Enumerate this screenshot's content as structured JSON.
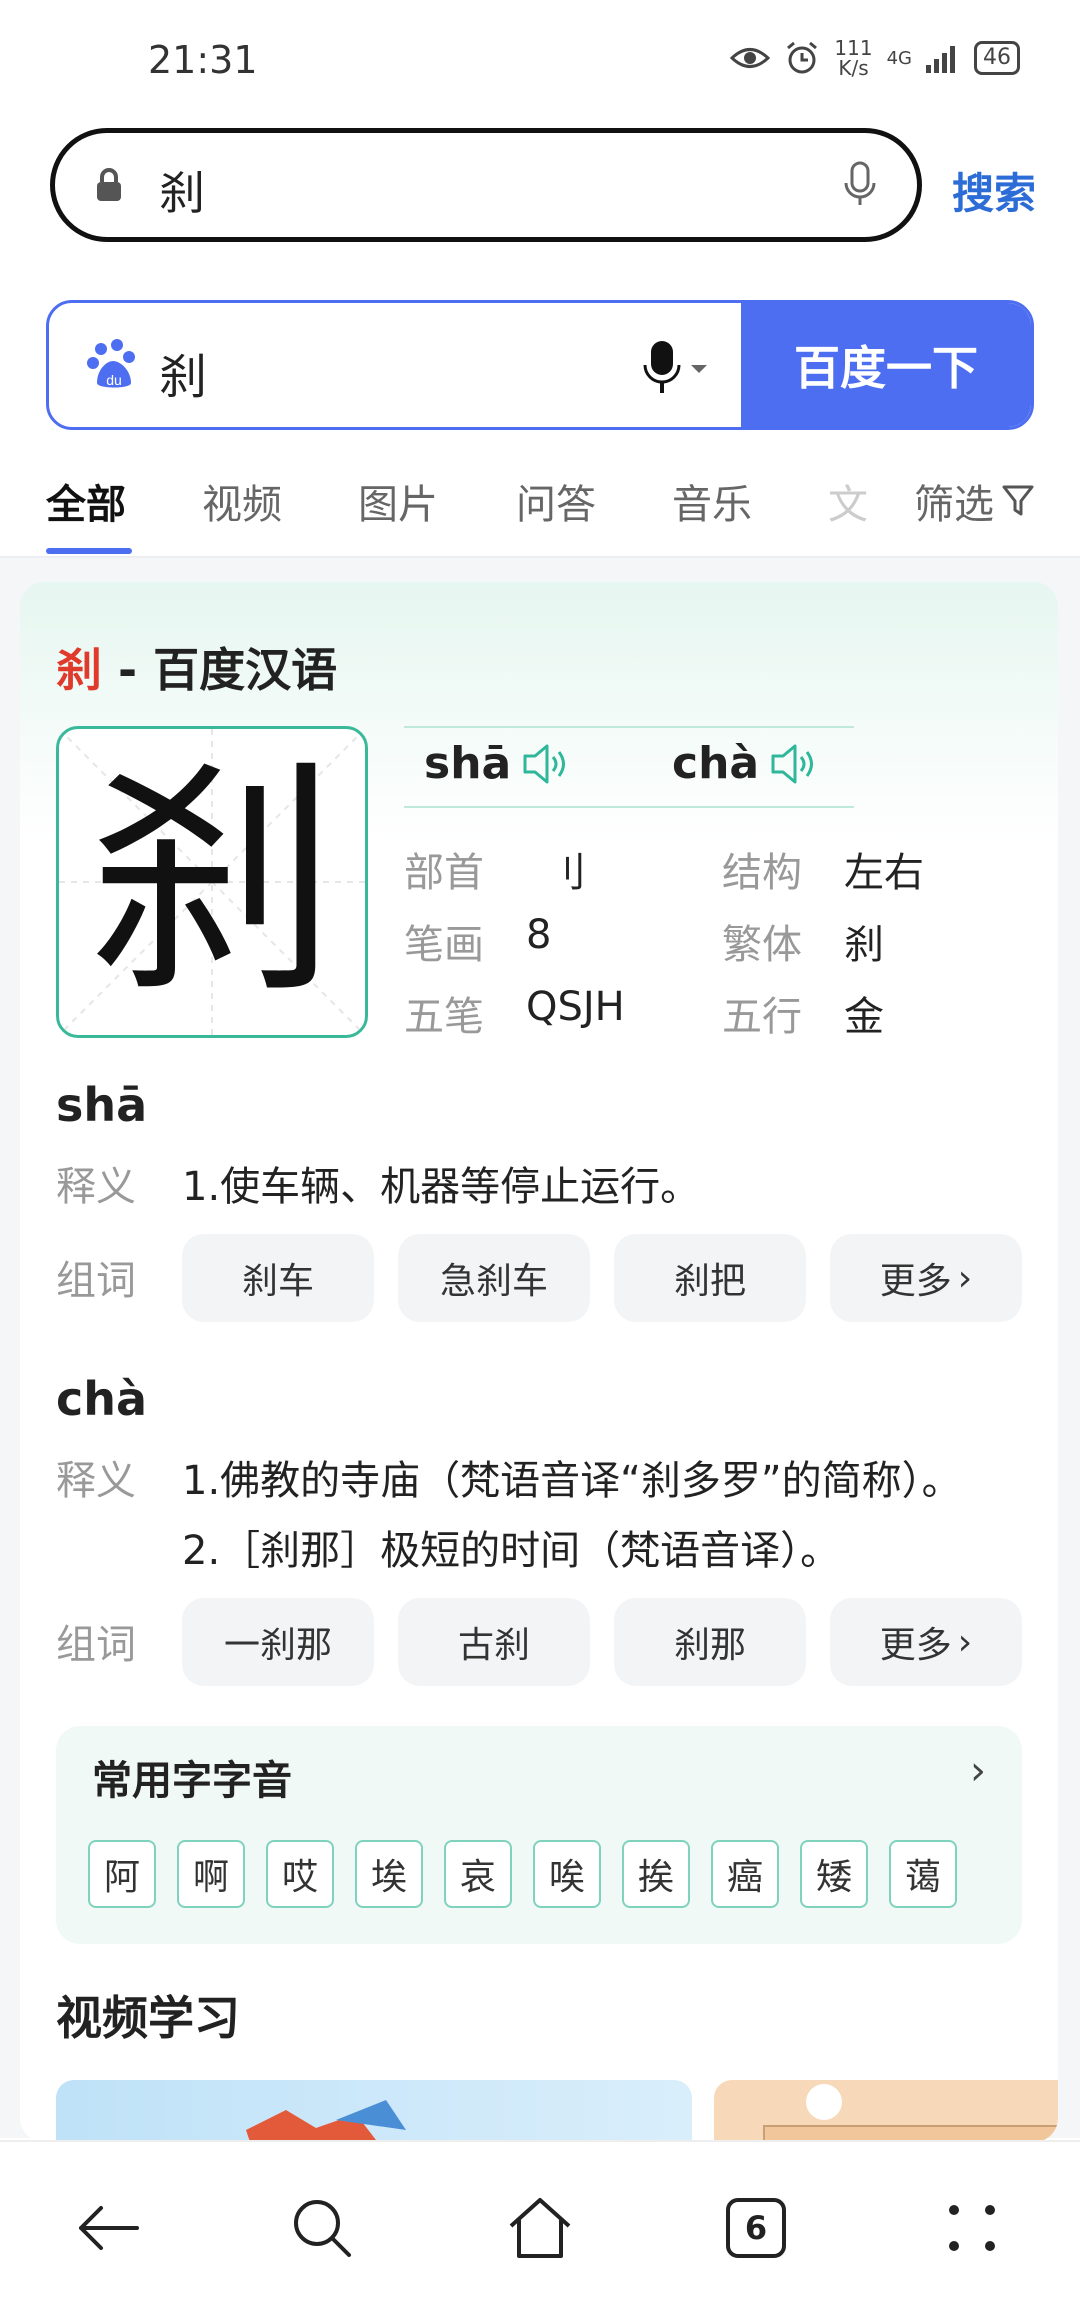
{
  "status": {
    "time": "21:31",
    "speed_value": "111",
    "speed_unit": "K/s",
    "network": "4G",
    "battery": "46"
  },
  "address_bar": {
    "query": "刹",
    "search_label": "搜索"
  },
  "search_box": {
    "query": "刹",
    "button_label": "百度一下"
  },
  "tabs": [
    {
      "label": "全部",
      "active": true
    },
    {
      "label": "视频"
    },
    {
      "label": "图片"
    },
    {
      "label": "问答"
    },
    {
      "label": "音乐"
    },
    {
      "label": "文"
    }
  ],
  "filter_label": "筛选",
  "dict_card": {
    "char": "刹",
    "source": " - 百度汉语",
    "pinyins": [
      "shā",
      "chà"
    ],
    "info": {
      "radical_label": "部首",
      "radical": "刂",
      "structure_label": "结构",
      "structure": "左右",
      "strokes_label": "笔画",
      "strokes": "8",
      "traditional_label": "繁体",
      "traditional": "刹",
      "wubi_label": "五笔",
      "wubi": "QSJH",
      "wuxing_label": "五行",
      "wuxing": "金"
    },
    "readings": [
      {
        "pinyin": "shā",
        "meaning_label": "释义",
        "meanings": [
          "1.使车辆、机器等停止运行。"
        ],
        "words_label": "组词",
        "words": [
          "刹车",
          "急刹车",
          "刹把"
        ],
        "more": "更多"
      },
      {
        "pinyin": "chà",
        "meaning_label": "释义",
        "meanings": [
          "1.佛教的寺庙（梵语音译“刹多罗”的简称）。",
          "2.［刹那］极短的时间（梵语音译）。"
        ],
        "words_label": "组词",
        "words": [
          "一刹那",
          "古刹",
          "刹那"
        ],
        "more": "更多"
      }
    ],
    "common_title": "常用字字音",
    "common_chars": [
      "阿",
      "啊",
      "哎",
      "埃",
      "哀",
      "唉",
      "挨",
      "癌",
      "矮",
      "蔼"
    ],
    "video_title": "视频学习"
  },
  "bottom_nav": {
    "tab_count": "6"
  },
  "colors": {
    "accent": "#4e6ef2",
    "teal": "#3ab99a",
    "red": "#e03a2c"
  }
}
